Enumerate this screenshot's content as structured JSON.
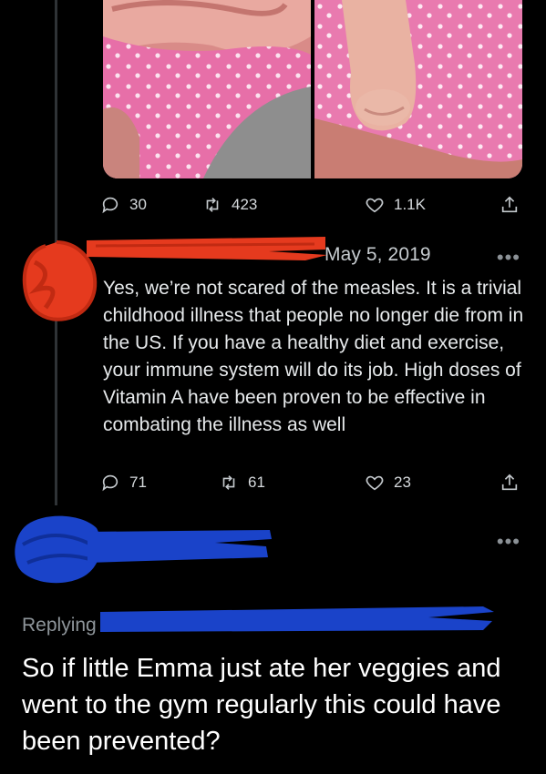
{
  "tweet1": {
    "stats": {
      "replies": "30",
      "retweets": "423",
      "likes": "1.1K"
    }
  },
  "tweet2": {
    "timestamp": "May 5, 2019",
    "text": "Yes, we’re not scared of the measles. It is a trivial childhood illness that people no longer die from in the US. If you have a healthy diet and exercise, your immune system will do its job. High doses of Vitamin A have been proven to be effective in combating the illness as well",
    "stats": {
      "replies": "71",
      "retweets": "61",
      "likes": "23"
    },
    "more": "•••"
  },
  "tweet3": {
    "more": "•••",
    "replying_label": "Replying",
    "text": "So if little Emma just ate her veggies and went to the gym regularly this could have been prevented?"
  },
  "colors": {
    "background": "#000000",
    "redaction_red": "#e53a1e",
    "redaction_blue": "#1a43c9",
    "icon_gray": "#c4c9cd",
    "muted_text": "#8e959a"
  },
  "icons": [
    "reply-icon",
    "retweet-icon",
    "like-icon",
    "share-icon",
    "more-icon"
  ]
}
